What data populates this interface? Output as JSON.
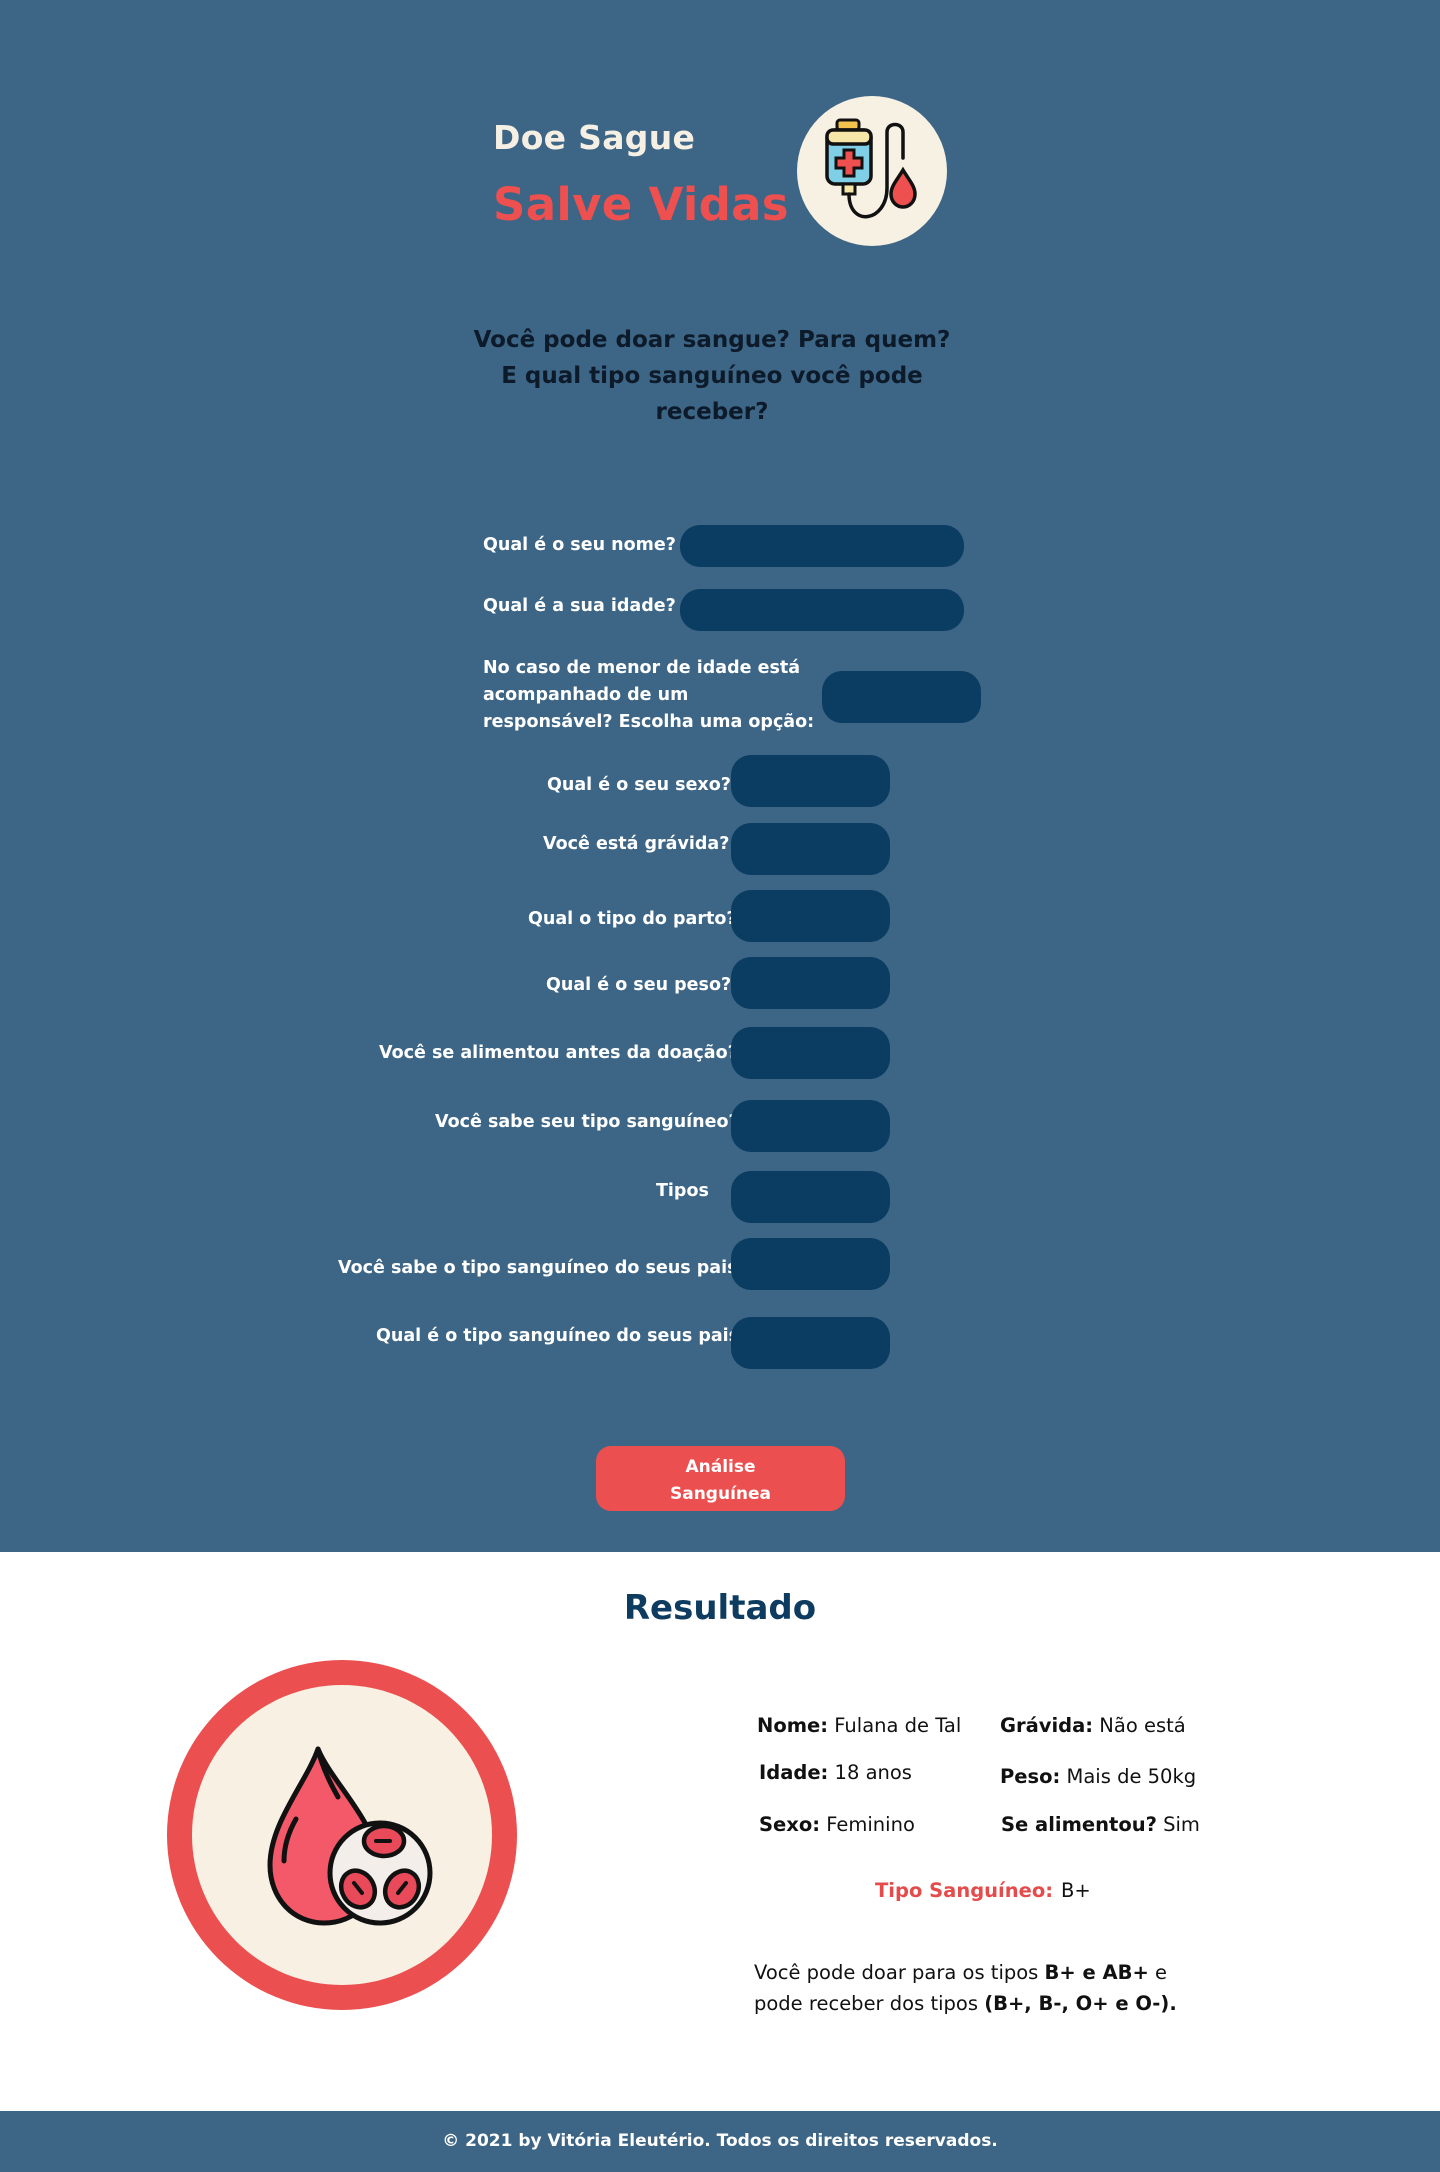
{
  "header": {
    "title_line1": "Doe Sague",
    "title_line2": "Salve Vidas",
    "logo_icon": "blood-bag-icon"
  },
  "intro": {
    "question": "Você pode doar sangue? Para quem? E qual tipo sanguíneo você pode receber?"
  },
  "form": {
    "name_label": "Qual é o seu nome?",
    "age_label": "Qual é a sua idade?",
    "guardian_label": "No caso de menor de idade está acompanhado de um responsável? Escolha uma opção:",
    "sex_label": "Qual é o seu sexo?",
    "pregnant_label": "Você está grávida?",
    "birth_label": "Qual o tipo do parto?",
    "weight_label": "Qual é o seu peso?",
    "fed_label": "Você se alimentou antes da doação?",
    "knows_type_label": "Você sabe seu tipo sanguíneo?",
    "types_label": "Tipos",
    "knows_parents_label": "Você sabe o tipo sanguíneo do seus pais?",
    "parents_type_label": "Qual é o tipo sanguíneo do seus pais?",
    "submit_line1": "Análise",
    "submit_line2": "Sanguínea"
  },
  "result": {
    "title": "Resultado",
    "icon": "blood-drop-cells-icon",
    "name_key": "Nome:",
    "name_value": " Fulana de Tal",
    "pregnant_key": "Grávida:",
    "pregnant_value": " Não está",
    "age_key": "Idade:",
    "age_value": " 18 anos",
    "weight_key": "Peso:",
    "weight_value": " Mais de 50kg",
    "sex_key": "Sexo:",
    "sex_value": " Feminino",
    "fed_key": "Se alimentou?",
    "fed_value": " Sim",
    "blood_type_key": "Tipo Sanguíneo:",
    "blood_type_value": "B+",
    "donate_prefix": "Você pode doar para os tipos ",
    "donate_types": "B+ e AB+",
    "donate_mid": " e pode receber dos tipos ",
    "receive_types": "(B+, B-, O+ e O-)."
  },
  "footer": {
    "text": "© 2021 by Vitória Eleutério. Todos os direitos reservados."
  },
  "colors": {
    "background_blue": "#3d6585",
    "field_navy": "#0b3d63",
    "accent_red": "#ec4f4f",
    "cream": "#f7f1e4"
  }
}
